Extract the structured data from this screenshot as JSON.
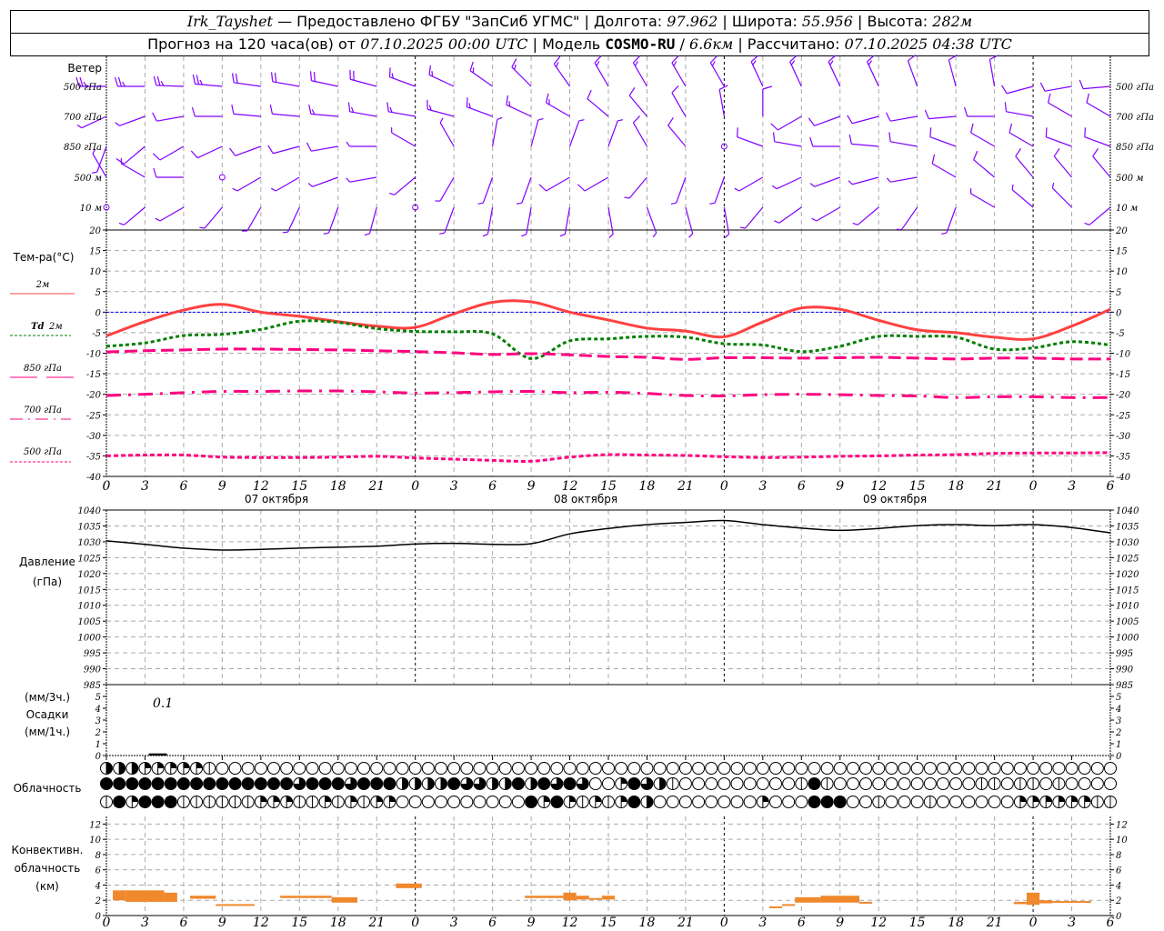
{
  "header": {
    "station": "Irk_Tayshet",
    "provider": "— Предоставлено ФГБУ \"ЗапСиб УГМС\"",
    "sep": "|",
    "lon_label": "Долгота:",
    "lon": "97.962",
    "lat_label": "Широта:",
    "lat": "55.956",
    "alt_label": "Высота:",
    "alt": "282м",
    "forecast_label": "Прогноз на 120 часа(ов) от",
    "forecast_start": "07.10.2025 00:00 UTC",
    "model_label": "| Модель",
    "model": "COSMO-RU",
    "model_sep": "/",
    "resolution": "6.6км",
    "computed_label": "| Рассчитано:",
    "computed": "07.10.2025 04:38 UTC"
  },
  "labels": {
    "wind": "Ветер",
    "levels": [
      "500 гПа",
      "700 гПа",
      "850 гПа",
      "500 м",
      "10 м"
    ],
    "temp_title": "Тем-ра(°C)",
    "leg_2m": "2м",
    "leg_td": "Td",
    "leg_td2": "2м",
    "leg_850": "850 гПа",
    "leg_700": "700 гПа",
    "leg_500": "500 гПа",
    "pressure": "Давление",
    "pressure_unit": "(гПа)",
    "precip_3h": "(мм/3ч.)",
    "precip": "Осадки",
    "precip_1h": "(мм/1ч.)",
    "precip_note": "0.1",
    "clouds": "Облачность",
    "conv1": "Конвективн.",
    "conv2": "облачность",
    "conv3": "(км)",
    "dates": [
      "07 октября",
      "08 октября",
      "09 октября"
    ]
  },
  "colors": {
    "wind": "#8000ff",
    "t2m": "#ff4040",
    "td2m": "#008000",
    "t850": "#ff0080",
    "t700": "#ff0080",
    "t500": "#ff0080",
    "zero": "#0000ff",
    "pressure": "#000000",
    "conv": "#f0882c",
    "grid": "#aaaaaa"
  },
  "chart_data": [
    {
      "type": "line",
      "title": "Тем-ра(°C)",
      "x_hours": [
        0,
        3,
        6,
        9,
        12,
        15,
        18,
        21,
        24,
        27,
        30,
        33,
        36,
        39,
        42,
        45,
        48,
        51,
        54,
        57,
        60,
        63,
        66,
        69,
        72,
        75,
        78
      ],
      "ylim": [
        -40,
        20
      ],
      "yticks": [
        20,
        15,
        10,
        5,
        0,
        -5,
        -10,
        -15,
        -20,
        -25,
        -30,
        -35,
        -40
      ],
      "grid": true,
      "series": [
        {
          "name": "2м",
          "values": [
            -5.8,
            -2.3,
            0.5,
            1.9,
            0,
            -1,
            -2.3,
            -3.4,
            -3.7,
            -0.4,
            2.4,
            2.5,
            0,
            -1.9,
            -3.9,
            -4.6,
            -6.0,
            -2.4,
            1.0,
            0.7,
            -2.0,
            -4.3,
            -5.0,
            -6.1,
            -6.5,
            -3.4,
            0.7
          ]
        },
        {
          "name": "Td 2м",
          "values": [
            -8.3,
            -7.5,
            -5.7,
            -5.4,
            -4.2,
            -2.2,
            -2.5,
            -4,
            -4.7,
            -4.8,
            -5.3,
            -11.3,
            -7.0,
            -6.5,
            -5.9,
            -6.1,
            -7.7,
            -8,
            -9.6,
            -8.3,
            -5.9,
            -5.9,
            -6.1,
            -9,
            -8.7,
            -7.2,
            -8
          ]
        },
        {
          "name": "850 гПа",
          "values": [
            -9.7,
            -9.4,
            -9.2,
            -9,
            -9,
            -9.1,
            -9.2,
            -9.4,
            -9.6,
            -9.9,
            -10.3,
            -10.1,
            -10.4,
            -10.8,
            -11.0,
            -11.5,
            -11.1,
            -11.1,
            -11.2,
            -11.1,
            -11.0,
            -11.2,
            -11.4,
            -11.2,
            -11.2,
            -11.4,
            -11.4
          ]
        },
        {
          "name": "700 гПа",
          "values": [
            -20.3,
            -20,
            -19.6,
            -19.3,
            -19.3,
            -19.2,
            -19.2,
            -19.4,
            -19.7,
            -19.6,
            -19.4,
            -19.3,
            -19.6,
            -19.5,
            -19.8,
            -20.3,
            -20.4,
            -20.1,
            -20.0,
            -20.1,
            -20.3,
            -20.4,
            -20.8,
            -20.6,
            -20.6,
            -20.8,
            -20.8
          ]
        },
        {
          "name": "500 гПа",
          "values": [
            -35,
            -34.8,
            -34.8,
            -35.3,
            -35.4,
            -35.4,
            -35.3,
            -35.1,
            -35.5,
            -35.8,
            -36.1,
            -36.3,
            -35.3,
            -34.7,
            -34.8,
            -34.9,
            -35.2,
            -35.4,
            -35.3,
            -35.1,
            -35,
            -34.8,
            -34.7,
            -34.4,
            -34.3,
            -34.3,
            -34.2
          ]
        }
      ]
    },
    {
      "type": "line",
      "title": "Давление (гПа)",
      "x_hours": [
        0,
        3,
        6,
        9,
        12,
        15,
        18,
        21,
        24,
        27,
        30,
        33,
        36,
        39,
        42,
        45,
        48,
        51,
        54,
        57,
        60,
        63,
        66,
        69,
        72,
        75,
        78
      ],
      "ylim": [
        985,
        1040
      ],
      "yticks": [
        1040,
        1035,
        1030,
        1025,
        1020,
        1015,
        1010,
        1005,
        1000,
        995,
        990,
        985
      ],
      "grid": true,
      "series": [
        {
          "name": "Давление",
          "values": [
            1030.3,
            1029.2,
            1028.0,
            1027.4,
            1027.6,
            1028.0,
            1028.3,
            1028.6,
            1029.3,
            1029.5,
            1029.2,
            1029.4,
            1032.5,
            1034.2,
            1035.4,
            1036.1,
            1036.7,
            1035.4,
            1034.3,
            1033.6,
            1034.2,
            1035.1,
            1035.4,
            1035.1,
            1035.4,
            1034.5,
            1032.8
          ]
        }
      ]
    },
    {
      "type": "bar",
      "title": "Осадки",
      "ylim": [
        0,
        5
      ],
      "yticks": [
        5,
        4,
        3,
        2,
        1,
        0
      ],
      "series": [
        {
          "name": "Осадки",
          "bars": [
            {
              "hour": 4,
              "value": 0.1
            }
          ]
        }
      ]
    },
    {
      "type": "table",
      "title": "Облачность",
      "note": "cloud cover in octas per hour (0-8), three rows, hours 0..78",
      "rows": [
        "4442222210000000000000000000000000000000000000000000000000000000000000000000000",
        "8888888888888886888688844448664484868600286410000000001810000000000011011010000",
        "1828881111112221121212200000000008282121284000000002000888001000100000022222211"
      ]
    },
    {
      "type": "bar",
      "title": "Конвективн. облачность (км)",
      "ylim": [
        0,
        13
      ],
      "yticks": [
        12,
        10,
        8,
        6,
        4,
        2,
        0
      ],
      "segments": [
        {
          "start": 0.5,
          "end": 1.5,
          "base": 2.0,
          "top": 3.3
        },
        {
          "start": 1.5,
          "end": 4.5,
          "base": 1.8,
          "top": 3.3
        },
        {
          "start": 4.5,
          "end": 5.5,
          "base": 1.8,
          "top": 3.0
        },
        {
          "start": 6.5,
          "end": 8.5,
          "base": 2.2,
          "top": 2.6
        },
        {
          "start": 8.5,
          "end": 11.5,
          "base": 1.3,
          "top": 1.5
        },
        {
          "start": 13.5,
          "end": 17.5,
          "base": 2.3,
          "top": 2.6
        },
        {
          "start": 17.5,
          "end": 19.5,
          "base": 1.7,
          "top": 2.4
        },
        {
          "start": 22.5,
          "end": 24.5,
          "base": 3.6,
          "top": 4.2
        },
        {
          "start": 32.5,
          "end": 35.5,
          "base": 2.3,
          "top": 2.6
        },
        {
          "start": 35.5,
          "end": 36.5,
          "base": 2.0,
          "top": 3.0
        },
        {
          "start": 36.5,
          "end": 37.5,
          "base": 2.1,
          "top": 2.6
        },
        {
          "start": 37.5,
          "end": 38.5,
          "base": 2.1,
          "top": 2.3
        },
        {
          "start": 38.5,
          "end": 39.5,
          "base": 2.1,
          "top": 2.6
        },
        {
          "start": 51.5,
          "end": 52.5,
          "base": 1.0,
          "top": 1.2
        },
        {
          "start": 52.5,
          "end": 53.5,
          "base": 1.3,
          "top": 1.5
        },
        {
          "start": 53.5,
          "end": 55.5,
          "base": 1.7,
          "top": 2.4
        },
        {
          "start": 55.5,
          "end": 58.5,
          "base": 1.7,
          "top": 2.6
        },
        {
          "start": 58.5,
          "end": 59.5,
          "base": 1.6,
          "top": 1.8
        },
        {
          "start": 70.5,
          "end": 71.5,
          "base": 1.5,
          "top": 1.8
        },
        {
          "start": 71.5,
          "end": 72.5,
          "base": 1.4,
          "top": 3.0
        },
        {
          "start": 72.5,
          "end": 73.5,
          "base": 1.6,
          "top": 2.0
        },
        {
          "start": 73.5,
          "end": 75.5,
          "base": 1.7,
          "top": 1.9
        },
        {
          "start": 75.5,
          "end": 76.5,
          "base": 1.7,
          "top": 1.9
        }
      ]
    },
    {
      "type": "scatter",
      "title": "Ветер",
      "note": "wind barbs every 3 h; direction in degrees, speed in m/s",
      "x_hours": [
        0,
        3,
        6,
        9,
        12,
        15,
        18,
        21,
        24,
        27,
        30,
        33,
        36,
        39,
        42,
        45,
        48,
        51,
        54,
        57,
        60,
        63,
        66,
        69,
        72,
        75,
        78
      ],
      "levels": [
        {
          "name": "500 гПа",
          "dir": [
            270,
            270,
            272,
            275,
            278,
            280,
            282,
            285,
            290,
            295,
            305,
            315,
            325,
            330,
            330,
            330,
            330,
            335,
            335,
            335,
            335,
            340,
            345,
            350,
            255,
            260,
            265
          ],
          "speed": [
            25,
            25,
            24,
            23,
            22,
            20,
            19,
            18,
            17,
            15,
            14,
            13,
            13,
            14,
            15,
            15,
            16,
            15,
            15,
            14,
            13,
            12,
            10,
            8,
            12,
            12,
            11
          ]
        },
        {
          "name": "700 гПа",
          "dir": [
            245,
            250,
            260,
            270,
            275,
            275,
            275,
            280,
            280,
            285,
            290,
            295,
            300,
            310,
            320,
            330,
            350,
            0,
            240,
            250,
            255,
            260,
            265,
            270,
            280,
            300,
            300
          ],
          "speed": [
            6,
            7,
            8,
            10,
            12,
            12,
            13,
            13,
            14,
            14,
            14,
            14,
            13,
            12,
            12,
            11,
            10,
            8,
            8,
            10,
            10,
            11,
            12,
            12,
            12,
            12,
            12
          ]
        },
        {
          "name": "850 гПа",
          "dir": [
            200,
            230,
            240,
            245,
            250,
            255,
            260,
            270,
            300,
            330,
            10,
            15,
            20,
            20,
            330,
            320,
            310,
            290,
            280,
            270,
            275,
            280,
            290,
            300,
            300,
            290,
            290
          ],
          "speed": [
            6,
            8,
            8,
            8,
            9,
            9,
            8,
            7,
            7,
            6,
            6,
            6,
            7,
            7,
            8,
            8,
            0,
            8,
            8,
            8,
            9,
            9,
            8,
            8,
            9,
            9,
            9
          ]
        },
        {
          "name": "500 м",
          "dir": [
            330,
            300,
            270,
            0,
            240,
            240,
            250,
            260,
            230,
            210,
            200,
            200,
            240,
            240,
            220,
            200,
            200,
            240,
            245,
            250,
            255,
            260,
            300,
            310,
            320,
            320,
            320
          ],
          "speed": [
            6,
            6,
            8,
            0,
            6,
            6,
            6,
            6,
            6,
            6,
            6,
            7,
            8,
            8,
            7,
            6,
            6,
            6,
            6,
            7,
            7,
            7,
            8,
            8,
            9,
            9,
            9
          ]
        },
        {
          "name": "10 м",
          "dir": [
            0,
            230,
            240,
            220,
            210,
            205,
            200,
            195,
            0,
            200,
            190,
            190,
            190,
            170,
            160,
            165,
            170,
            220,
            235,
            240,
            230,
            215,
            200,
            300,
            310,
            315,
            230
          ],
          "speed": [
            0,
            4,
            5,
            4,
            4,
            4,
            3,
            3,
            0,
            3,
            3,
            3,
            3,
            4,
            4,
            3,
            3,
            4,
            5,
            5,
            5,
            4,
            3,
            5,
            5,
            5,
            5
          ]
        }
      ]
    }
  ]
}
